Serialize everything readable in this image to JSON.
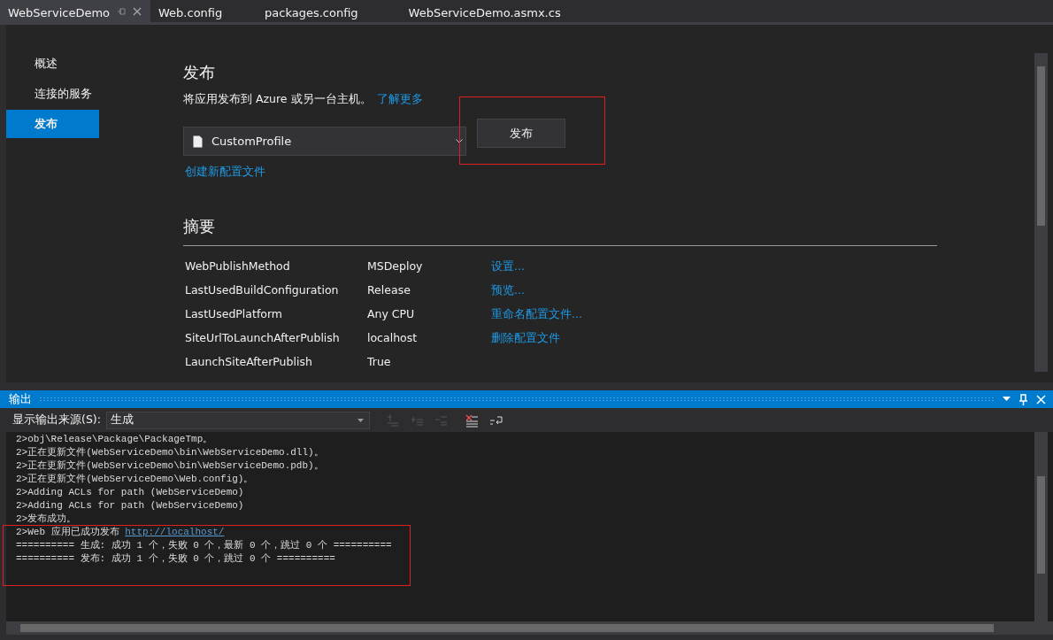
{
  "doc_tabs": [
    {
      "label": "WebServiceDemo",
      "selected": true
    },
    {
      "label": "Web.config",
      "selected": false
    },
    {
      "label": "packages.config",
      "selected": false
    },
    {
      "label": "WebServiceDemo.asmx.cs",
      "selected": false
    }
  ],
  "nav": [
    {
      "label": "概述",
      "selected": false
    },
    {
      "label": "连接的服务",
      "selected": false
    },
    {
      "label": "发布",
      "selected": true
    }
  ],
  "publish": {
    "title": "发布",
    "description": "将应用发布到 Azure 或另一台主机。",
    "learn_more": "了解更多",
    "profile": "CustomProfile",
    "button": "发布",
    "highlighted": true,
    "create_profile": "创建新配置文件"
  },
  "summary": {
    "title": "摘要",
    "rows": [
      {
        "name": "WebPublishMethod",
        "value": "MSDeploy",
        "action": "设置..."
      },
      {
        "name": "LastUsedBuildConfiguration",
        "value": "Release",
        "action": "预览..."
      },
      {
        "name": "LastUsedPlatform",
        "value": "Any CPU",
        "action": "重命名配置文件..."
      },
      {
        "name": "SiteUrlToLaunchAfterPublish",
        "value": "localhost",
        "action": "删除配置文件"
      },
      {
        "name": "LaunchSiteAfterPublish",
        "value": "True"
      }
    ]
  },
  "output": {
    "title": "输出",
    "source_label": "显示输出来源(S):",
    "source": "生成",
    "lines": [
      {
        "text": "2>obj\\Release\\Package\\PackageTmp。",
        "highlighted": false
      },
      {
        "text": "2>正在更新文件(WebServiceDemo\\bin\\WebServiceDemo.dll)。",
        "highlighted": false
      },
      {
        "text": "2>正在更新文件(WebServiceDemo\\bin\\WebServiceDemo.pdb)。",
        "highlighted": false
      },
      {
        "text": "2>正在更新文件(WebServiceDemo\\Web.config)。",
        "highlighted": false
      },
      {
        "text": "2>Adding ACLs for path (WebServiceDemo)",
        "highlighted": false
      },
      {
        "text": "2>Adding ACLs for path (WebServiceDemo)",
        "highlighted": false
      },
      {
        "text": "2>发布成功。",
        "highlighted": false
      },
      {
        "text": "2>Web 应用已成功发布 ",
        "link": "http://localhost/",
        "highlighted": true
      },
      {
        "text": "========== 生成: 成功 1 个，失败 0 个，最新 0 个，跳过 0 个 ==========",
        "highlighted": true
      },
      {
        "text": "========== 发布: 成功 1 个，失败 0 个，跳过 0 个 ==========",
        "highlighted": true
      }
    ]
  }
}
